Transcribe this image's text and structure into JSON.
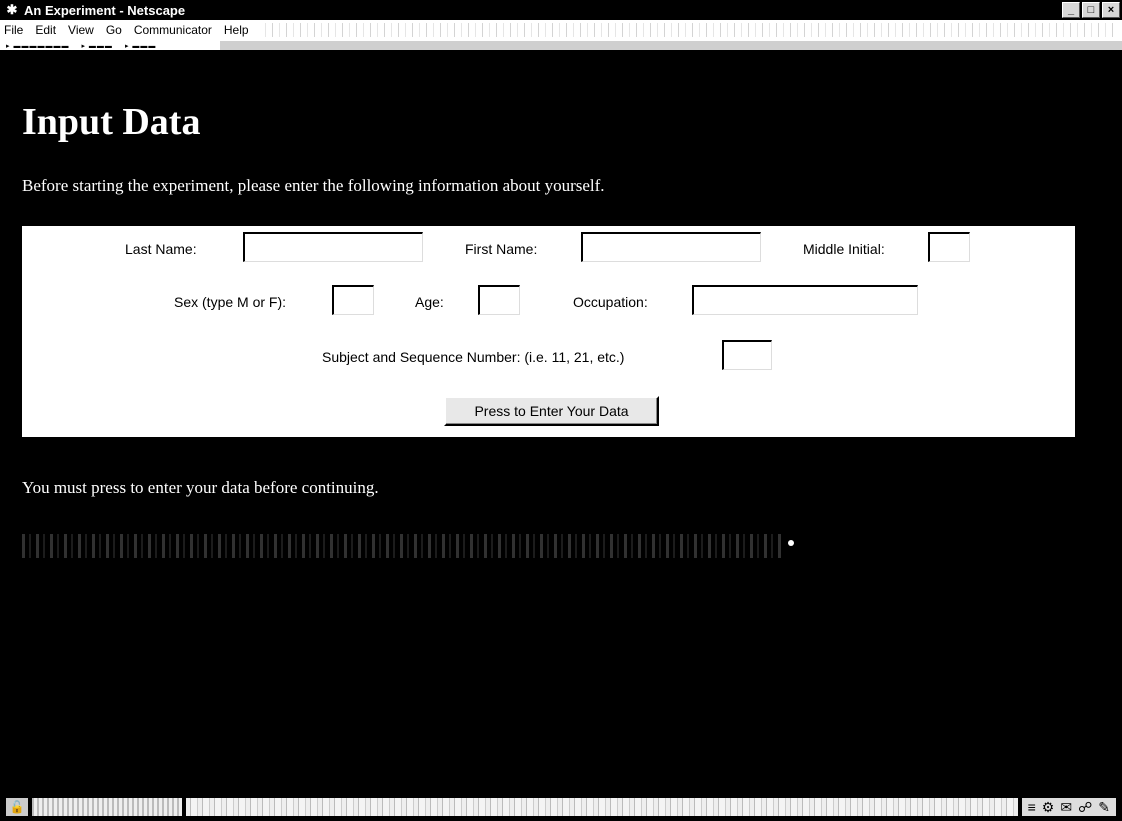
{
  "window": {
    "title": "An Experiment - Netscape",
    "controls": [
      "_",
      "□",
      "×"
    ]
  },
  "menubar": {
    "items": [
      "File",
      "Edit",
      "View",
      "Go",
      "Communicator",
      "Help"
    ]
  },
  "page": {
    "heading": "Input Data",
    "intro": "Before starting the experiment, please enter the following information about yourself.",
    "notice": "You must press to enter your data before continuing."
  },
  "form": {
    "last_name_label": "Last Name:",
    "last_name_value": "",
    "first_name_label": "First Name:",
    "first_name_value": "",
    "middle_initial_label": "Middle Initial:",
    "middle_initial_value": "",
    "sex_label": "Sex (type M or F):",
    "sex_value": "",
    "age_label": "Age:",
    "age_value": "",
    "occupation_label": "Occupation:",
    "occupation_value": "",
    "subject_label": "Subject and Sequence Number: (i.e. 11, 21, etc.)",
    "subject_value": "",
    "submit_label": "Press to Enter Your Data"
  },
  "icons": {
    "app": "netscape-icon",
    "lock": "security-lock-icon",
    "status_tray": [
      "document-icon",
      "network-icon",
      "mail-icon",
      "discussion-icon",
      "compose-icon"
    ]
  }
}
